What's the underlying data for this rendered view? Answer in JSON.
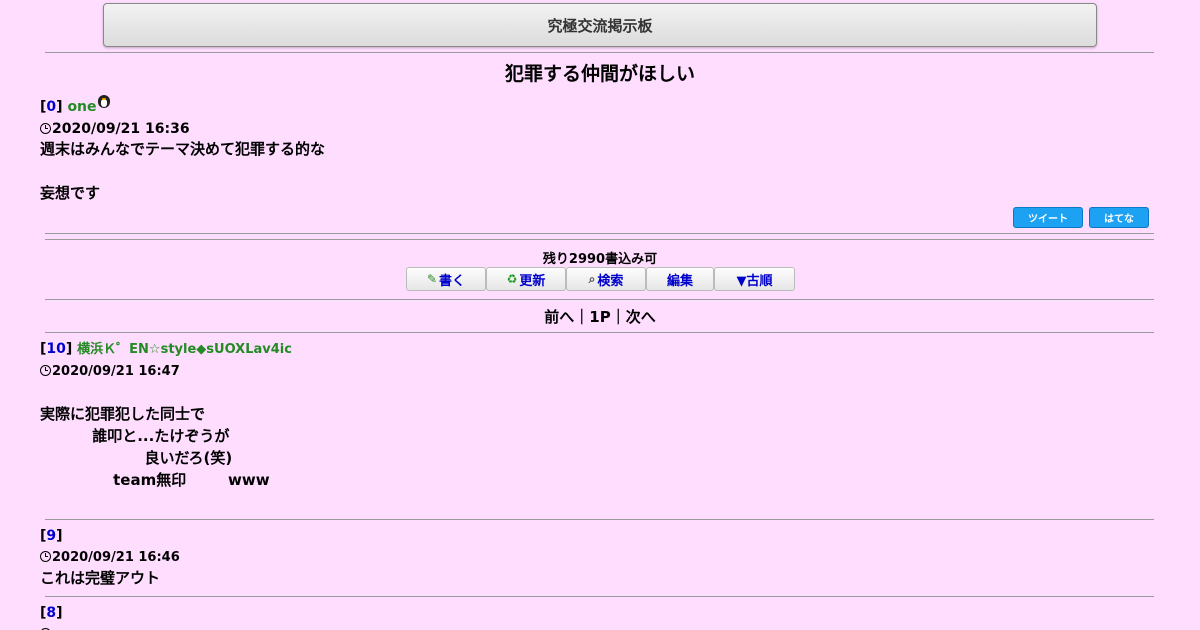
{
  "header": {
    "title": "究極交流掲示板"
  },
  "thread": {
    "title": "犯罪する仲間がほしい"
  },
  "op": {
    "num": "0",
    "name": "one",
    "date": "2020/09/21 16:36",
    "body": "週末はみんなでテーマ決めて犯罪する的な\n\n妄想です"
  },
  "share": {
    "tweet": "ツイート",
    "hatena": "はてな"
  },
  "remaining": "残り2990書込み可",
  "toolbar": {
    "write": "書く",
    "refresh": "更新",
    "search": "検索",
    "edit": "編集",
    "order": "▼古順"
  },
  "pager": {
    "prev": "前へ",
    "sep": "｜",
    "page": "1P",
    "next": "次へ"
  },
  "posts": [
    {
      "num": "10",
      "name": "横浜Ｋ゜EN☆style◆sUOXLav4ic",
      "date": "2020/09/21 16:47",
      "body": "\n実際に犯罪犯した同士で\n          誰叩と...たけぞうが\n                    良いだろ(笑)\n              team無印        www"
    },
    {
      "num": "9",
      "date": "2020/09/21 16:46",
      "body": "これは完璧アウト"
    },
    {
      "num": "8"
    }
  ]
}
